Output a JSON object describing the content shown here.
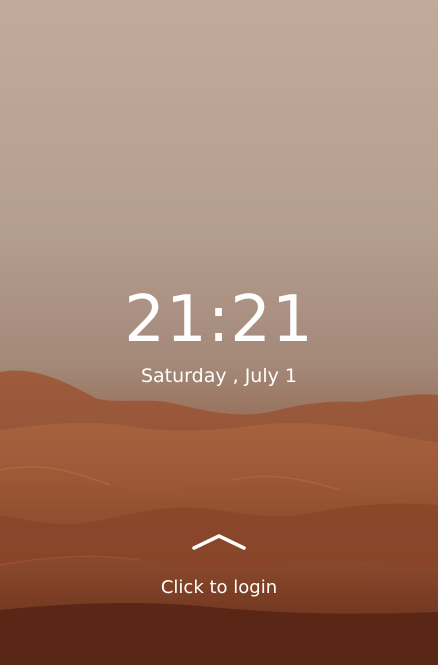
{
  "lockscreen": {
    "time": "21:21",
    "date": "Saturday , July 1",
    "login_prompt": "Click to login",
    "swipe_icon": "chevron-up-icon",
    "colors": {
      "sky_top": "#c2aa9a",
      "dune_light": "#a05d3c",
      "dune_dark": "#6e3421",
      "text": "#ffffff"
    }
  }
}
